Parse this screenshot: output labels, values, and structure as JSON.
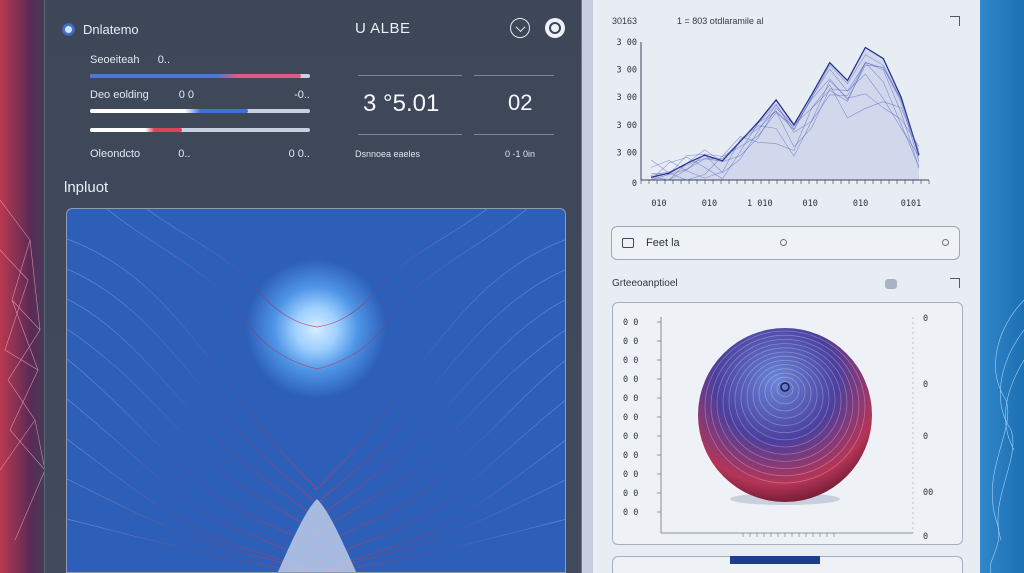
{
  "app": {
    "title": "Dnlatemo",
    "center_title": "U ALBE"
  },
  "sliders": [
    {
      "label": "Seoeiteah",
      "left_value": "0..",
      "right_value": "",
      "value": 0.96,
      "color": "#4a78d6",
      "accent": "#e05a86"
    },
    {
      "label": "Deo eolding",
      "left_value": "0 0",
      "right_value": "-0..",
      "value": 0.72,
      "color": "#ffffff",
      "accent": "#3d6fd8"
    },
    {
      "label": "",
      "left_value": "",
      "right_value": "",
      "value": 0.42,
      "color": "#ffffff",
      "accent": "#d84458"
    }
  ],
  "bottom_row": {
    "label": "Oleondcto",
    "left_value": "0..",
    "right_value": "0 0.."
  },
  "metrics": [
    {
      "value": "3 °5.01",
      "caption": "Dsnnoea eaeles"
    },
    {
      "value": "02",
      "caption": "0 -1 0in"
    }
  ],
  "section_title": "lnpluot",
  "top_chart": {
    "header_left": "30163",
    "header_right": "1 = 803 otdlaramile al"
  },
  "search": {
    "label": "Feet la"
  },
  "section2_title": "Grteeoanptioel",
  "chart_data": [
    {
      "type": "area",
      "x_tick_labels": [
        "010",
        "010",
        "1 010",
        "010",
        "010",
        "0101"
      ],
      "y_tick_labels": [
        "0",
        "3 00",
        "3 00",
        "3 00",
        "3 00",
        "3 00"
      ],
      "series": [
        {
          "values": [
            0.02,
            0.05,
            0.12,
            0.18,
            0.14,
            0.28,
            0.42,
            0.58,
            0.4,
            0.62,
            0.85,
            0.72,
            0.96,
            0.88,
            0.6,
            0.18
          ]
        }
      ]
    },
    {
      "type": "scatter",
      "y_tick_labels": [
        "0 0",
        "0 0",
        "0 0",
        "0 0",
        "0 0",
        "0 0",
        "0 0",
        "0 0",
        "0 0",
        "0 0",
        "0 0"
      ],
      "right_tick_labels": [
        "0",
        "0",
        "0",
        "00",
        "0"
      ]
    }
  ],
  "colors": {
    "accent": "#2d3f9c",
    "warn": "#c8374f",
    "panel": "#414b5d"
  }
}
